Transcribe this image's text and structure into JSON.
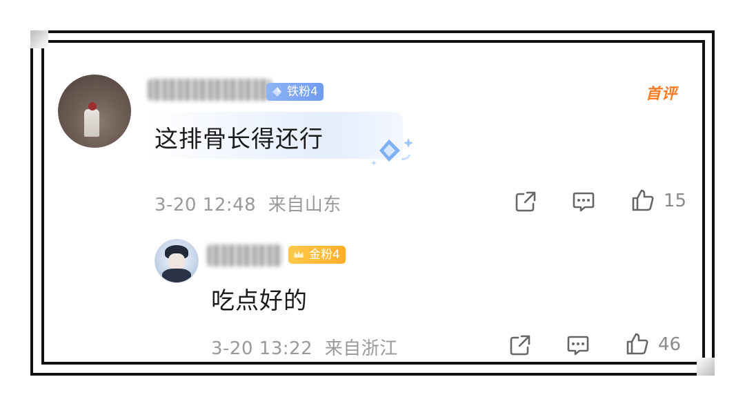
{
  "comments": [
    {
      "badge": "铁粉4",
      "tag": "首评",
      "text": "这排骨长得还行",
      "time": "3-20 12:48",
      "location": "来自山东",
      "likes": "15"
    }
  ],
  "reply": {
    "badge": "金粉4",
    "text": "吃点好的",
    "time": "3-20 13:22",
    "location": "来自浙江",
    "likes": "46"
  },
  "colors": {
    "iron_badge": "#6f9bf0",
    "gold_badge": "#ffae2a",
    "top_tag": "#ff7a1f",
    "meta_text": "#999999"
  }
}
